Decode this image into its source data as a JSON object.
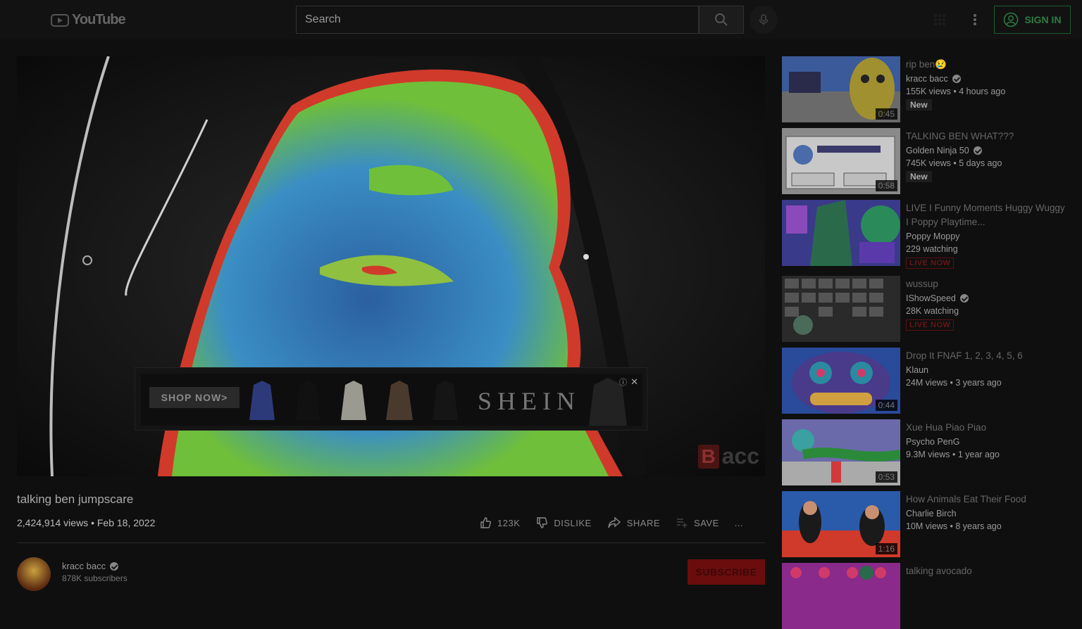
{
  "header": {
    "logo_text": "YouTube",
    "search_placeholder": "Search",
    "signin_label": "SIGN IN"
  },
  "ad": {
    "shop_label": "SHOP NOW>",
    "brand": "SHEIN",
    "close": "✕",
    "info": "ⓘ"
  },
  "watermark": {
    "letter": "B",
    "text": "acc"
  },
  "video": {
    "title": "talking ben jumpscare",
    "meta": "2,424,914 views • Feb 18, 2022",
    "likes": "123K",
    "dislike_label": "DISLIKE",
    "share_label": "SHARE",
    "save_label": "SAVE",
    "more": "..."
  },
  "channel": {
    "name": "kracc bacc",
    "subscribers": "878K subscribers",
    "subscribe_label": "SUBSCRIBE"
  },
  "recommendations": [
    {
      "title": "rip ben😢",
      "channel": "kracc bacc",
      "verified": true,
      "meta": "155K views • 4 hours ago",
      "badge": "New",
      "duration": "0:45"
    },
    {
      "title": "TALKING BEN WHAT???",
      "channel": "Golden Ninja 50",
      "verified": true,
      "meta": "745K views • 5 days ago",
      "badge": "New",
      "duration": "0:58"
    },
    {
      "title": "LIVE I Funny Moments Huggy Wuggy I Poppy Playtime...",
      "channel": "Poppy Moppy",
      "verified": false,
      "meta": "229 watching",
      "badge": "LIVE NOW",
      "duration": ""
    },
    {
      "title": "wussup",
      "channel": "IShowSpeed",
      "verified": true,
      "meta": "28K watching",
      "badge": "LIVE NOW",
      "duration": ""
    },
    {
      "title": "Drop It FNAF 1, 2, 3, 4, 5, 6",
      "channel": "Klaun",
      "verified": false,
      "meta": "24M views • 3 years ago",
      "badge": "",
      "duration": "0:44"
    },
    {
      "title": "Xue Hua Piao Piao",
      "channel": "Psycho PenG",
      "verified": false,
      "meta": "9.3M views • 1 year ago",
      "badge": "",
      "duration": "0:53"
    },
    {
      "title": "How Animals Eat Their Food",
      "channel": "Charlie Birch",
      "verified": false,
      "meta": "10M views • 8 years ago",
      "badge": "",
      "duration": "1:16"
    },
    {
      "title": "talking avocado",
      "channel": "",
      "verified": false,
      "meta": "",
      "badge": "",
      "duration": ""
    }
  ]
}
